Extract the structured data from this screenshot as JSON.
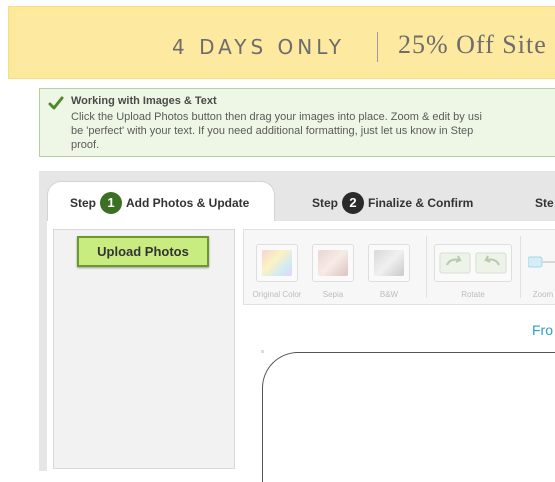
{
  "promo": {
    "left_text": "4 DAYS ONLY",
    "right_text": "25% Off Site"
  },
  "info": {
    "title": "Working with Images & Text",
    "body": "Click the Upload Photos button then drag your images into place. Zoom & edit by usi\nbe 'perfect' with your text. If you need additional formatting, just let us know in Step\nproof."
  },
  "tabs": [
    {
      "prefix": "Step",
      "number": "1",
      "label": "Add Photos & Update"
    },
    {
      "prefix": "Step",
      "number": "2",
      "label": "Finalize & Confirm"
    },
    {
      "prefix": "Ste",
      "number": "",
      "label": ""
    }
  ],
  "sidebar": {
    "upload_label": "Upload Photos"
  },
  "toolbar": {
    "tools": [
      {
        "label": "Original Color",
        "icon": "original-color-swatch-icon"
      },
      {
        "label": "Sepia",
        "icon": "sepia-swatch-icon"
      },
      {
        "label": "B&W",
        "icon": "bw-swatch-icon"
      },
      {
        "label": "Rotate",
        "icon": "rotate-icon"
      },
      {
        "label": "Zoom",
        "icon": "zoom-slider-icon"
      }
    ]
  },
  "canvas": {
    "front_label": "Fro"
  },
  "colors": {
    "banner": "#fde99a",
    "info_bg": "#eef7e6",
    "upload_button": "#c8ec7f",
    "step_active": "#3b6f23",
    "link": "#2aa0c0"
  }
}
